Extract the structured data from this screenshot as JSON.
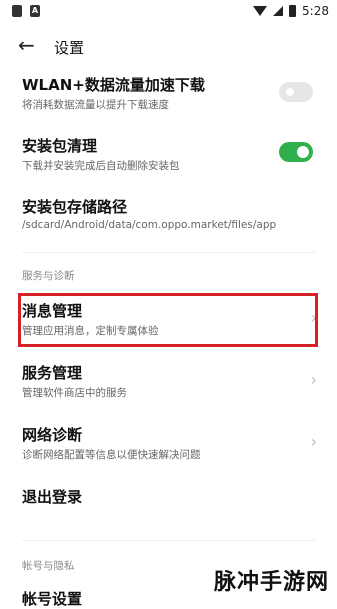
{
  "status": {
    "time": "5:28",
    "left_icons": [
      "notification-icon",
      "a-icon"
    ]
  },
  "header": {
    "title": "设置"
  },
  "settings": [
    {
      "title": "WLAN+数据流量加速下载",
      "subtitle": "将消耗数据流量以提升下载速度",
      "toggle": false
    },
    {
      "title": "安装包清理",
      "subtitle": "下载并安装完成后自动删除安装包",
      "toggle": true
    },
    {
      "title": "安装包存储路径",
      "subtitle": "/sdcard/Android/data/com.oppo.market/files/app"
    }
  ],
  "section1": "服务与诊断",
  "services": [
    {
      "title": "消息管理",
      "subtitle": "管理应用消息，定制专属体验"
    },
    {
      "title": "服务管理",
      "subtitle": "管理软件商店中的服务"
    },
    {
      "title": "网络诊断",
      "subtitle": "诊断网络配置等信息以便快速解决问题"
    },
    {
      "title": "退出登录"
    }
  ],
  "section2": "帐号与隐私",
  "partial_item": "帐号设置",
  "watermark": "脉冲手游网",
  "colors": {
    "toggle_on": "#2fb04d",
    "highlight": "#d61f26"
  }
}
